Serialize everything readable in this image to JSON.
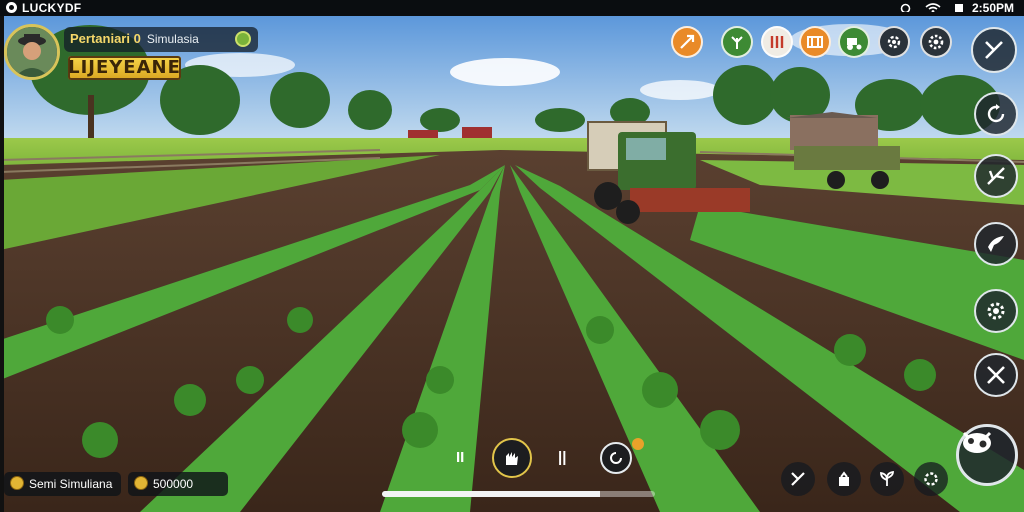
{
  "status_bar": {
    "app_name": "LUCKYDF",
    "time": "2:50PM"
  },
  "player": {
    "name": "Pertaniari 0",
    "subtitle": "Simulasia",
    "logo_text": "LIJEYEANE"
  },
  "top_icons": [
    "speed-icon",
    "leaf-icon",
    "market-icon",
    "stats-icon",
    "tractor-icon",
    "gear-icon",
    "settings-icon"
  ],
  "right_menu": [
    "tools-icon",
    "rotate-icon",
    "branch-icon",
    "bird-icon",
    "gear-icon",
    "crossed-tools-icon"
  ],
  "action_bar": {
    "pause_label": "II",
    "item_label": "||"
  },
  "progress": {
    "value": 0.8
  },
  "currency": {
    "label_1": "Semi Simuliana",
    "label_2": "500000"
  },
  "colors": {
    "gold": "#f5d86a",
    "hud_dark": "#1e262d",
    "sky": "#7aa8d8",
    "crop": "#4fa83a"
  }
}
